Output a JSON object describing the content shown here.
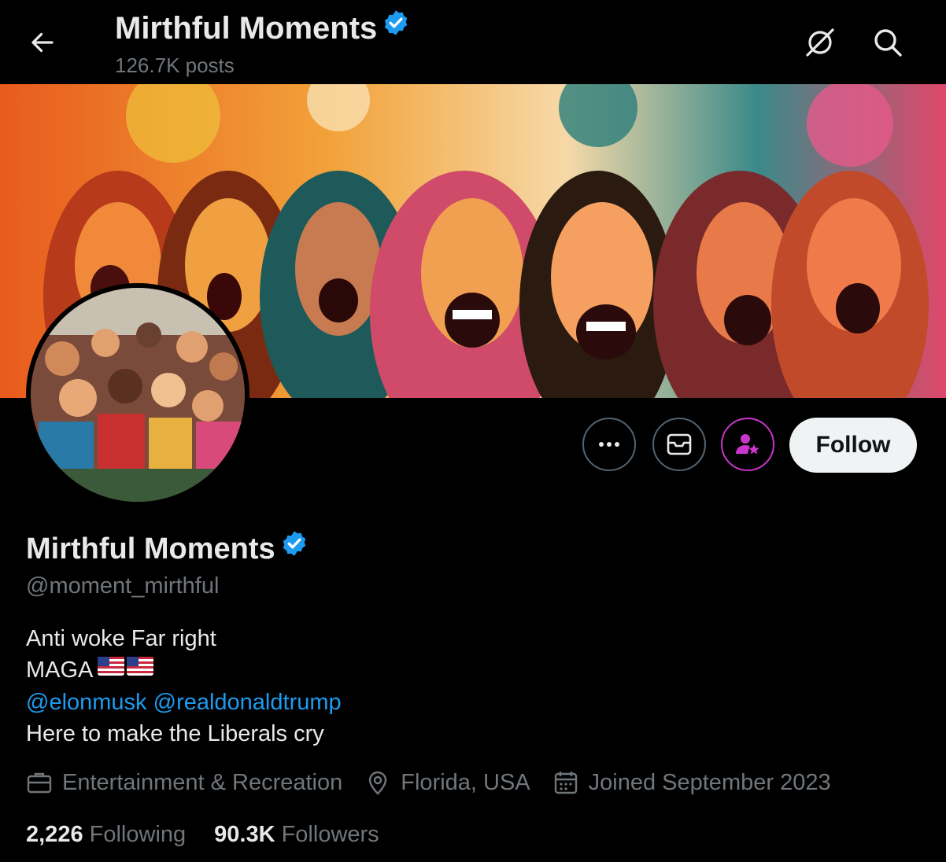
{
  "header": {
    "title": "Mirthful Moments",
    "posts_count": "126.7K posts"
  },
  "profile": {
    "display_name": "Mirthful Moments",
    "handle": "@moment_mirthful",
    "bio": {
      "line1": "Anti woke Far right",
      "line2": "MAGA",
      "mention1": "@elonmusk",
      "mention2": "@realdonaldtrump",
      "line4": "Here to make the Liberals cry"
    },
    "category": "Entertainment & Recreation",
    "location": "Florida, USA",
    "joined": "Joined September 2023",
    "following_count": "2,226",
    "following_label": "Following",
    "followers_count": "90.3K",
    "followers_label": "Followers"
  },
  "actions": {
    "follow_label": "Follow"
  },
  "icons": {
    "back": "arrow-left-icon",
    "grok": "grok-icon",
    "search": "search-icon",
    "more": "more-icon",
    "message": "envelope-icon",
    "subscribe": "subscribe-star-icon",
    "verified": "verified-badge-icon",
    "category": "briefcase-icon",
    "location": "location-pin-icon",
    "joined": "calendar-icon",
    "flag": "us-flag-icon"
  },
  "colors": {
    "background": "#000000",
    "text_primary": "#e7e9ea",
    "text_secondary": "#71767b",
    "accent_blue": "#1d9bf0",
    "subscribe_purple": "#c936cc",
    "follow_bg": "#eff3f4"
  }
}
